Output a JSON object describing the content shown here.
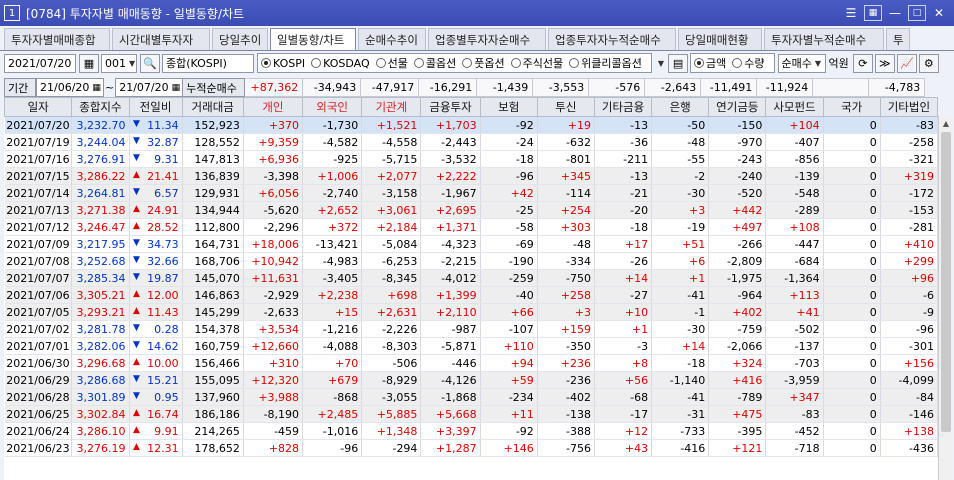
{
  "window": {
    "number": "1",
    "title": "[0784] 투자자별 매매동향 - 일별동향/차트"
  },
  "tabs": [
    "투자자별매매종합",
    "시간대별투자자",
    "당일추이",
    "일별동향/차트",
    "순매수추이",
    "업종별투자자순매수",
    "업종투자자누적순매수",
    "당일매매현황",
    "투자자별누적순매수",
    "투"
  ],
  "active_tab": 3,
  "toolbar": {
    "date": "2021/07/20",
    "code": "001",
    "market_name": "종합(KOSPI)",
    "markets": [
      "KOSPI",
      "KOSDAQ",
      "선물",
      "콜옵션",
      "풋옵션",
      "주식선물",
      "위클리콜옵션"
    ],
    "mode_options": [
      "금액",
      "수량"
    ],
    "mode_selected": "금액",
    "net_select": "순매수",
    "unit": "억원"
  },
  "period": {
    "label": "기간",
    "from": "21/06/20",
    "sep": "~",
    "to": "21/07/20",
    "sum_label": "누적순매수",
    "sums": [
      "+87,362",
      "-34,943",
      "-47,917",
      "-16,291",
      "-1,439",
      "-3,553",
      "-576",
      "-2,643",
      "-11,491",
      "-11,924",
      "",
      "-4,783"
    ]
  },
  "columns": [
    "일자",
    "종합지수",
    "전일비",
    "거래대금",
    "개인",
    "외국인",
    "기관계",
    "금융투자",
    "보험",
    "투신",
    "기타금융",
    "은행",
    "연기금등",
    "사모펀드",
    "국가",
    "기타법인"
  ],
  "rows": [
    [
      "2021/07/20",
      "3,232.70",
      "dn",
      "11.34",
      "152,923",
      "+370",
      "-1,730",
      "+1,521",
      "+1,703",
      "-92",
      "+19",
      "-13",
      "-50",
      "-150",
      "+104",
      "0",
      "-83"
    ],
    [
      "2021/07/19",
      "3,244.04",
      "dn",
      "32.87",
      "128,552",
      "+9,359",
      "-4,582",
      "-4,558",
      "-2,443",
      "-24",
      "-632",
      "-36",
      "-48",
      "-970",
      "-407",
      "0",
      "-258"
    ],
    [
      "2021/07/16",
      "3,276.91",
      "dn",
      "9.31",
      "147,813",
      "+6,936",
      "-925",
      "-5,715",
      "-3,532",
      "-18",
      "-801",
      "-211",
      "-55",
      "-243",
      "-856",
      "0",
      "-321"
    ],
    [
      "2021/07/15",
      "3,286.22",
      "up",
      "21.41",
      "136,839",
      "-3,398",
      "+1,006",
      "+2,077",
      "+2,222",
      "-96",
      "+345",
      "-13",
      "-2",
      "-240",
      "-139",
      "0",
      "+319"
    ],
    [
      "2021/07/14",
      "3,264.81",
      "dn",
      "6.57",
      "129,931",
      "+6,056",
      "-2,740",
      "-3,158",
      "-1,967",
      "+42",
      "-114",
      "-21",
      "-30",
      "-520",
      "-548",
      "0",
      "-172"
    ],
    [
      "2021/07/13",
      "3,271.38",
      "up",
      "24.91",
      "134,944",
      "-5,620",
      "+2,652",
      "+3,061",
      "+2,695",
      "-25",
      "+254",
      "-20",
      "+3",
      "+442",
      "-289",
      "0",
      "-153"
    ],
    [
      "2021/07/12",
      "3,246.47",
      "up",
      "28.52",
      "112,800",
      "-2,296",
      "+372",
      "+2,184",
      "+1,371",
      "-58",
      "+303",
      "-18",
      "-19",
      "+497",
      "+108",
      "0",
      "-281"
    ],
    [
      "2021/07/09",
      "3,217.95",
      "dn",
      "34.73",
      "164,731",
      "+18,006",
      "-13,421",
      "-5,084",
      "-4,323",
      "-69",
      "-48",
      "+17",
      "+51",
      "-266",
      "-447",
      "0",
      "+410"
    ],
    [
      "2021/07/08",
      "3,252.68",
      "dn",
      "32.66",
      "168,706",
      "+10,942",
      "-4,983",
      "-6,253",
      "-2,215",
      "-190",
      "-334",
      "-26",
      "+6",
      "-2,809",
      "-684",
      "0",
      "+299"
    ],
    [
      "2021/07/07",
      "3,285.34",
      "dn",
      "19.87",
      "145,070",
      "+11,631",
      "-3,405",
      "-8,345",
      "-4,012",
      "-259",
      "-750",
      "+14",
      "+1",
      "-1,975",
      "-1,364",
      "0",
      "+96"
    ],
    [
      "2021/07/06",
      "3,305.21",
      "up",
      "12.00",
      "146,863",
      "-2,929",
      "+2,238",
      "+698",
      "+1,399",
      "-40",
      "+258",
      "-27",
      "-41",
      "-964",
      "+113",
      "0",
      "-6"
    ],
    [
      "2021/07/05",
      "3,293.21",
      "up",
      "11.43",
      "145,299",
      "-2,633",
      "+15",
      "+2,631",
      "+2,110",
      "+66",
      "+3",
      "+10",
      "-1",
      "+402",
      "+41",
      "0",
      "-9"
    ],
    [
      "2021/07/02",
      "3,281.78",
      "dn",
      "0.28",
      "154,378",
      "+3,534",
      "-1,216",
      "-2,226",
      "-987",
      "-107",
      "+159",
      "+1",
      "-30",
      "-759",
      "-502",
      "0",
      "-96"
    ],
    [
      "2021/07/01",
      "3,282.06",
      "dn",
      "14.62",
      "160,759",
      "+12,660",
      "-4,088",
      "-8,303",
      "-5,871",
      "+110",
      "-350",
      "-3",
      "+14",
      "-2,066",
      "-137",
      "0",
      "-301"
    ],
    [
      "2021/06/30",
      "3,296.68",
      "up",
      "10.00",
      "156,466",
      "+310",
      "+70",
      "-506",
      "-446",
      "+94",
      "+236",
      "+8",
      "-18",
      "+324",
      "-703",
      "0",
      "+156"
    ],
    [
      "2021/06/29",
      "3,286.68",
      "dn",
      "15.21",
      "155,095",
      "+12,320",
      "+679",
      "-8,929",
      "-4,126",
      "+59",
      "-236",
      "+56",
      "-1,140",
      "+416",
      "-3,959",
      "0",
      "-4,099"
    ],
    [
      "2021/06/28",
      "3,301.89",
      "dn",
      "0.95",
      "137,960",
      "+3,988",
      "-868",
      "-3,055",
      "-1,868",
      "-234",
      "-402",
      "-68",
      "-41",
      "-789",
      "+347",
      "0",
      "-84"
    ],
    [
      "2021/06/25",
      "3,302.84",
      "up",
      "16.74",
      "186,186",
      "-8,190",
      "+2,485",
      "+5,885",
      "+5,668",
      "+11",
      "-138",
      "-17",
      "-31",
      "+475",
      "-83",
      "0",
      "-146"
    ],
    [
      "2021/06/24",
      "3,286.10",
      "up",
      "9.91",
      "214,265",
      "-459",
      "-1,016",
      "+1,348",
      "+3,397",
      "-92",
      "-388",
      "+12",
      "-733",
      "-395",
      "-452",
      "0",
      "+138"
    ],
    [
      "2021/06/23",
      "3,276.19",
      "up",
      "12.31",
      "178,652",
      "+828",
      "-96",
      "-294",
      "+1,287",
      "+146",
      "-756",
      "+43",
      "-416",
      "+121",
      "-718",
      "0",
      "-436"
    ]
  ]
}
